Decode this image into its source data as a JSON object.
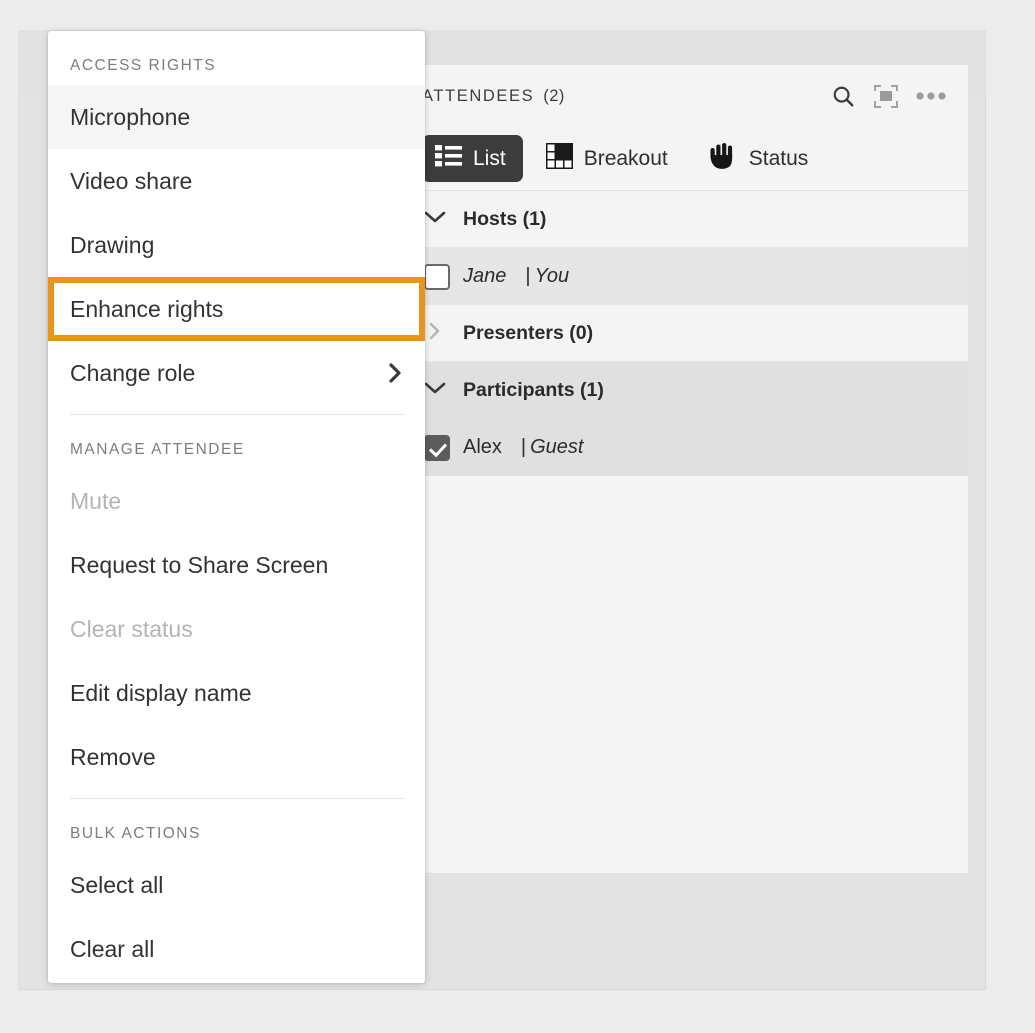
{
  "context_menu": {
    "sections": [
      {
        "title": "ACCESS RIGHTS",
        "items": [
          {
            "label": "Microphone",
            "state": "hover"
          },
          {
            "label": "Video share",
            "state": "normal"
          },
          {
            "label": "Drawing",
            "state": "normal"
          },
          {
            "label": "Enhance rights",
            "state": "highlighted"
          },
          {
            "label": "Change role",
            "state": "normal",
            "icon": "chevron-right-icon"
          }
        ]
      },
      {
        "title": "MANAGE ATTENDEE",
        "items": [
          {
            "label": "Mute",
            "state": "disabled"
          },
          {
            "label": "Request to Share Screen",
            "state": "normal"
          },
          {
            "label": "Clear status",
            "state": "disabled"
          },
          {
            "label": "Edit display name",
            "state": "normal"
          },
          {
            "label": "Remove",
            "state": "normal"
          }
        ]
      },
      {
        "title": "BULK ACTIONS",
        "items": [
          {
            "label": "Select all",
            "state": "normal"
          },
          {
            "label": "Clear all",
            "state": "normal"
          }
        ]
      }
    ],
    "highlight_color": "#e8941f"
  },
  "attendees": {
    "header": {
      "title": "ATTENDEES",
      "count": "(2)",
      "actions": [
        {
          "name": "search-icon"
        },
        {
          "name": "expand-icon"
        },
        {
          "name": "more-options-icon"
        }
      ]
    },
    "tabs": [
      {
        "label": "List",
        "icon": "list-icon",
        "active": true
      },
      {
        "label": "Breakout",
        "icon": "grid-icon",
        "active": false
      },
      {
        "label": "Status",
        "icon": "raised-hand-icon",
        "active": false
      }
    ],
    "groups": [
      {
        "label": "Hosts (1)",
        "expanded": true,
        "people": [
          {
            "name": "Jane",
            "role": "You",
            "checked": false,
            "name_italic": true
          }
        ]
      },
      {
        "label": "Presenters (0)",
        "expanded": false,
        "people": []
      },
      {
        "label": "Participants (1)",
        "expanded": true,
        "people": [
          {
            "name": "Alex",
            "role": "Guest",
            "checked": true,
            "name_italic": false
          }
        ]
      }
    ]
  }
}
